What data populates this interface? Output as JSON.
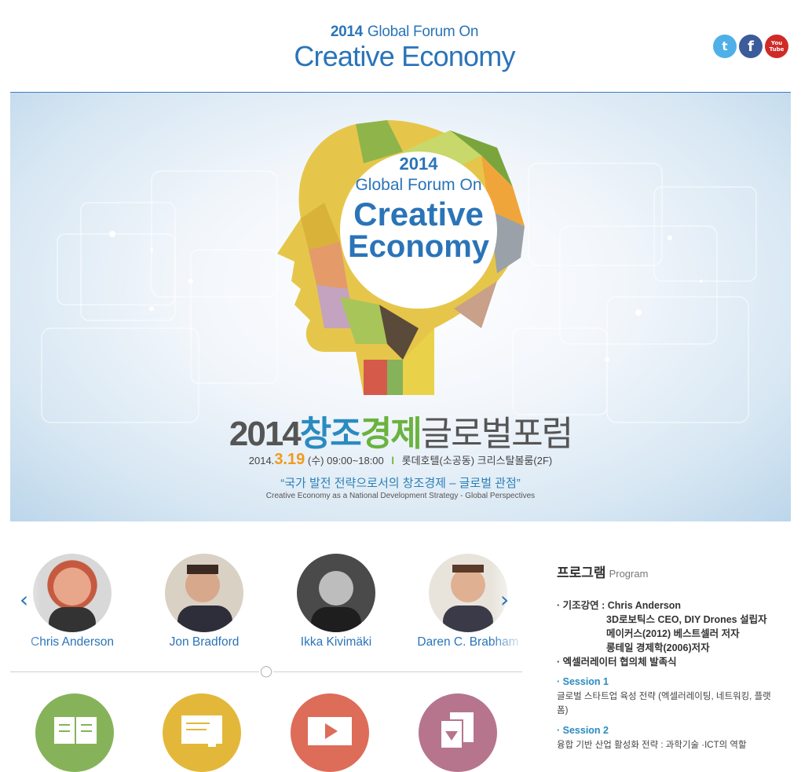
{
  "header": {
    "logo_line1_year": "2014",
    "logo_line1_text": "Global Forum On",
    "logo_line2": "Creative Economy",
    "social": [
      {
        "name": "twitter-icon",
        "glyph": "t"
      },
      {
        "name": "facebook-icon",
        "glyph": "f"
      },
      {
        "name": "youtube-icon",
        "glyph_top": "You",
        "glyph_bottom": "Tube"
      }
    ]
  },
  "banner": {
    "head_year": "2014",
    "head_line1": "Global Forum On",
    "head_line2": "Creative",
    "head_line3": "Economy",
    "title_part1": "2014",
    "title_part2": "창조",
    "title_part3": "경제",
    "title_part4": "글로벌포럼",
    "date_prefix": "2014.",
    "date_big": "3.19",
    "date_rest": "(수) 09:00~18:00",
    "date_sep": "l",
    "venue": "롯데호텔(소공동) 크리스탈볼룸(2F)",
    "quote": "“국가 발전 전략으로서의 창조경제 – 글로벌 관점”",
    "subtitle": "Creative Economy as a National Development Strategy - Global Perspectives"
  },
  "speakers": {
    "prev_arrow": "‹",
    "next_arrow": "›",
    "items": [
      {
        "name": "Chris Anderson"
      },
      {
        "name": "Jon Bradford"
      },
      {
        "name": "Ikka Kivimäki"
      },
      {
        "name": "Daren C. Brabham"
      }
    ]
  },
  "menu_icons": [
    {
      "name": "book-icon",
      "color": "#86b35a"
    },
    {
      "name": "presentation-icon",
      "color": "#e3b83a"
    },
    {
      "name": "video-icon",
      "color": "#dd6c58"
    },
    {
      "name": "download-icon",
      "color": "#b6758d"
    }
  ],
  "program": {
    "title": "프로그램",
    "title_en": "Program",
    "keynote_label": "· 기조강연 : Chris Anderson",
    "keynote_lines": [
      "3D로보틱스 CEO, DIY Drones 설립자",
      "메이커스(2012) 베스트셀러 저자",
      "롱테일 경제학(2006)저자"
    ],
    "accelerator": "· 엑셀러레이터 협의체 발족식",
    "sessions": [
      {
        "title": "· Session 1",
        "desc": "글로벌 스타트업 육성 전략 (엑셀러레이팅, 네트워킹, 플랫폼)"
      },
      {
        "title": "· Session 2",
        "desc": "융합 기반 산업 활성화 전략 : 과학기술 ·ICT의 역할"
      }
    ]
  },
  "colors": {
    "brand_blue": "#2a74b8",
    "green": "#6ab33f",
    "orange": "#f19a1a"
  }
}
